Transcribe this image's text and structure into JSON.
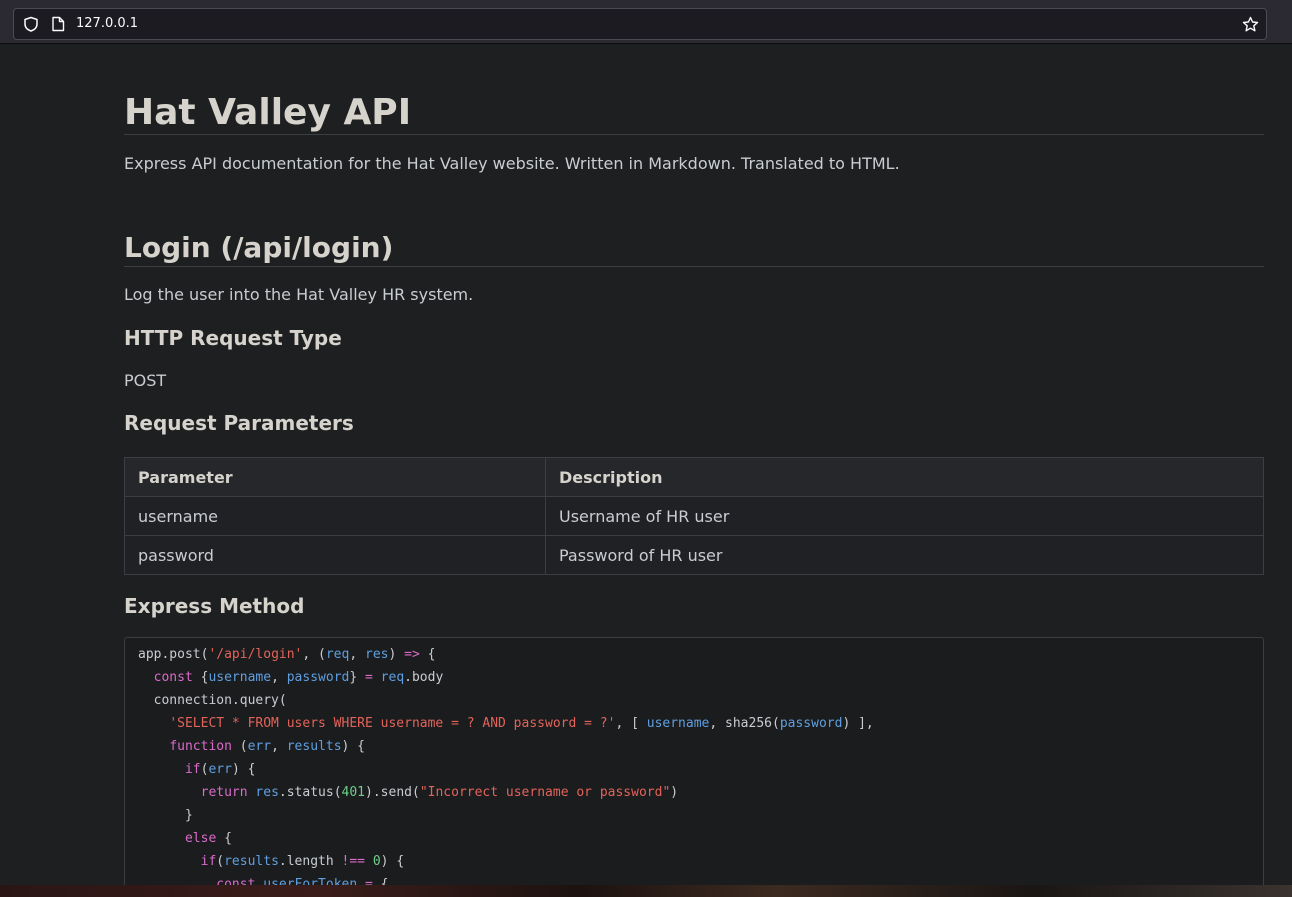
{
  "browser": {
    "url": "127.0.0.1"
  },
  "doc": {
    "title": "Hat Valley API",
    "intro": "Express API documentation for the Hat Valley website. Written in Markdown. Translated to HTML.",
    "section": {
      "title": "Login (/api/login)",
      "description": "Log the user into the Hat Valley HR system.",
      "request_type_heading": "HTTP Request Type",
      "request_type": "POST",
      "params_heading": "Request Parameters",
      "params_table": {
        "headers": [
          "Parameter",
          "Description"
        ],
        "rows": [
          [
            "username",
            "Username of HR user"
          ],
          [
            "password",
            "Password of HR user"
          ]
        ]
      },
      "method_heading": "Express Method"
    }
  },
  "code": [
    [
      [
        "t",
        "app.post("
      ],
      [
        "s",
        "'/api/login'"
      ],
      [
        "t",
        ", ("
      ],
      [
        "v",
        "req"
      ],
      [
        "t",
        ", "
      ],
      [
        "v",
        "res"
      ],
      [
        "t",
        ") "
      ],
      [
        "k",
        "=>"
      ],
      [
        "t",
        " {"
      ]
    ],
    [
      [
        "t",
        "  "
      ],
      [
        "k",
        "const"
      ],
      [
        "t",
        " {"
      ],
      [
        "v",
        "username"
      ],
      [
        "t",
        ", "
      ],
      [
        "v",
        "password"
      ],
      [
        "t",
        "} "
      ],
      [
        "k",
        "="
      ],
      [
        "t",
        " "
      ],
      [
        "v",
        "req"
      ],
      [
        "t",
        ".body"
      ]
    ],
    [
      [
        "t",
        "  connection.query("
      ]
    ],
    [
      [
        "t",
        "    "
      ],
      [
        "s",
        "'SELECT * FROM users WHERE username = ? AND password = ?'"
      ],
      [
        "t",
        ", [ "
      ],
      [
        "v",
        "username"
      ],
      [
        "t",
        ", sha256("
      ],
      [
        "v",
        "password"
      ],
      [
        "t",
        ") ],"
      ]
    ],
    [
      [
        "t",
        "    "
      ],
      [
        "k",
        "function"
      ],
      [
        "t",
        " ("
      ],
      [
        "v",
        "err"
      ],
      [
        "t",
        ", "
      ],
      [
        "v",
        "results"
      ],
      [
        "t",
        ") {"
      ]
    ],
    [
      [
        "t",
        "      "
      ],
      [
        "k",
        "if"
      ],
      [
        "t",
        "("
      ],
      [
        "v",
        "err"
      ],
      [
        "t",
        ") {"
      ]
    ],
    [
      [
        "t",
        "        "
      ],
      [
        "k",
        "return"
      ],
      [
        "t",
        " "
      ],
      [
        "v",
        "res"
      ],
      [
        "t",
        ".status("
      ],
      [
        "n",
        "401"
      ],
      [
        "t",
        ").send("
      ],
      [
        "s",
        "\"Incorrect username or password\""
      ],
      [
        "t",
        ")"
      ]
    ],
    [
      [
        "t",
        "      }"
      ]
    ],
    [
      [
        "t",
        "      "
      ],
      [
        "k",
        "else"
      ],
      [
        "t",
        " {"
      ]
    ],
    [
      [
        "t",
        "        "
      ],
      [
        "k",
        "if"
      ],
      [
        "t",
        "("
      ],
      [
        "v",
        "results"
      ],
      [
        "t",
        ".length "
      ],
      [
        "k",
        "!=="
      ],
      [
        "t",
        " "
      ],
      [
        "n",
        "0"
      ],
      [
        "t",
        ") {"
      ]
    ],
    [
      [
        "t",
        "          "
      ],
      [
        "k",
        "const"
      ],
      [
        "t",
        " "
      ],
      [
        "v",
        "userForToken"
      ],
      [
        "t",
        " "
      ],
      [
        "k",
        "="
      ],
      [
        "t",
        " {"
      ]
    ]
  ]
}
